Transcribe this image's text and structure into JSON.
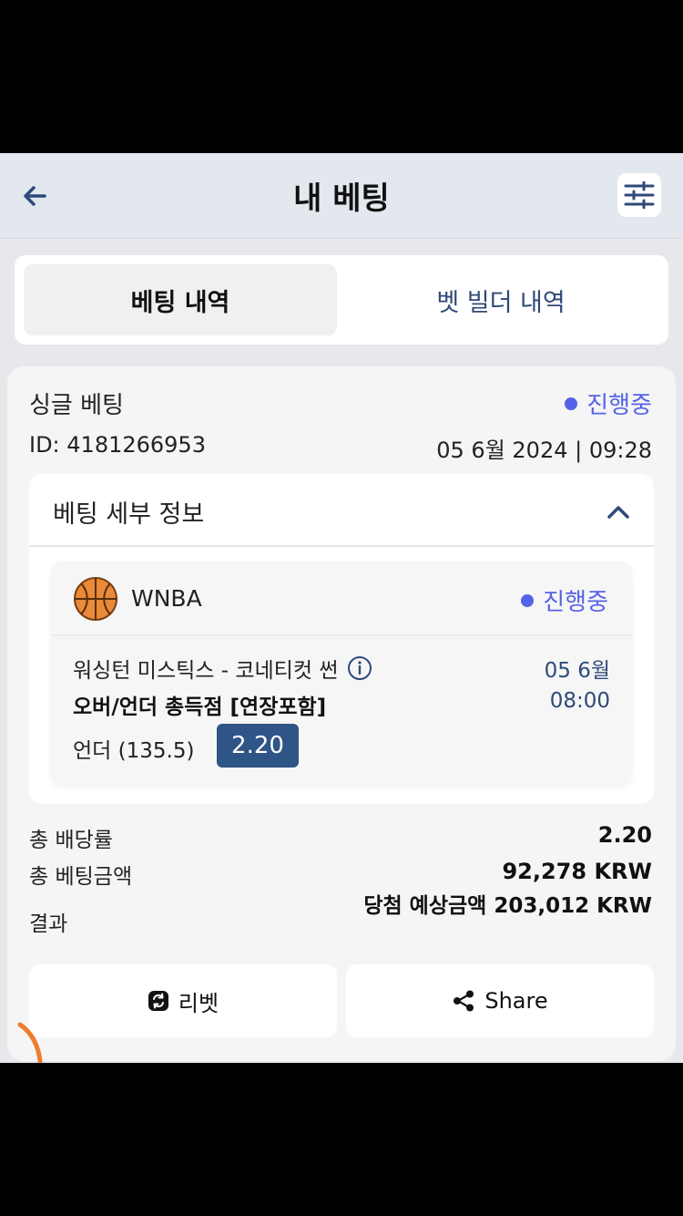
{
  "header": {
    "title": "내 베팅",
    "back_icon": "arrow-left-icon",
    "filter_icon": "sliders-icon"
  },
  "tabs": [
    {
      "label": "베팅 내역",
      "active": true
    },
    {
      "label": "벳 빌더 내역",
      "active": false
    }
  ],
  "bet": {
    "type": "싱글 베팅",
    "status": "진행중",
    "id": "ID: 4181266953",
    "date": "05 6월 2024 | 09:28",
    "details_title": "베팅 세부 정보",
    "event": {
      "league": "WNBA",
      "league_icon": "basketball-icon",
      "status": "진행중",
      "match": "워싱턴 미스틱스 - 코네티컷 썬",
      "market": "오버/언더 총득점 [연장포함]",
      "date": "05 6월",
      "time": "08:00",
      "selection": "언더 (135.5)",
      "odds": "2.20"
    },
    "summary": {
      "total_odds_label": "총 배당률",
      "total_odds_value": "2.20",
      "stake_label": "총 베팅금액",
      "stake_value": "92,278 KRW",
      "result_label": "결과",
      "result_value": "당첨 예상금액 203,012 KRW"
    },
    "actions": {
      "rebet_label": "리벳",
      "share_label": "Share"
    }
  },
  "colors": {
    "accent": "#5563e6",
    "navy": "#2e4a78",
    "odds_badge": "#2f5486",
    "ball": "#e88a3a"
  }
}
